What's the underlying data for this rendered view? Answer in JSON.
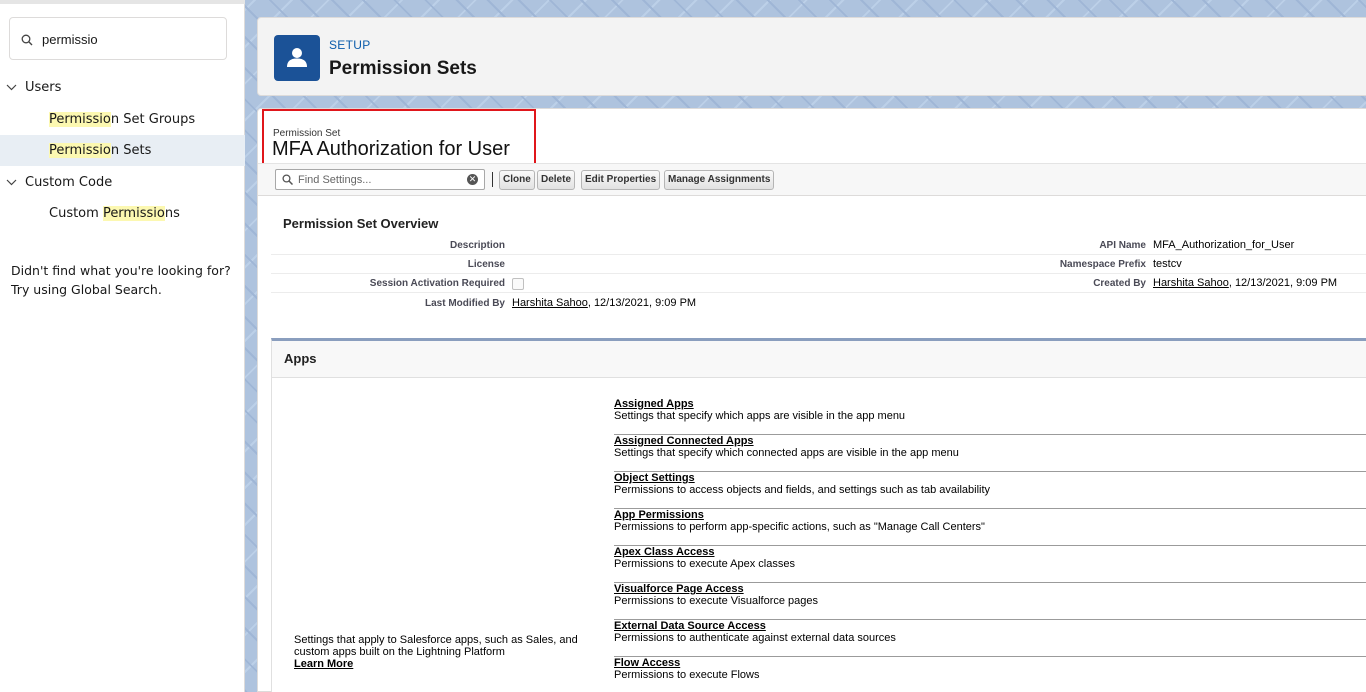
{
  "sidebar": {
    "search_value": "permissio",
    "tree": [
      {
        "label": "Users",
        "children": [
          {
            "match": "Permissio",
            "rest": "n Set Groups"
          },
          {
            "match": "Permissio",
            "rest": "n Sets",
            "selected": true
          }
        ]
      },
      {
        "label": "Custom Code",
        "children": [
          {
            "prefix": "Custom ",
            "match": "Permissio",
            "rest": "ns"
          }
        ]
      }
    ],
    "not_found_line1": "Didn't find what you're looking for?",
    "not_found_line2": "Try using Global Search."
  },
  "header": {
    "setup_link": "SETUP",
    "title": "Permission Sets"
  },
  "permission_set": {
    "type_label": "Permission Set",
    "name": "MFA Authorization for User"
  },
  "toolbar": {
    "find_placeholder": "Find Settings...",
    "clone": "Clone",
    "delete": "Delete",
    "edit_properties": "Edit Properties",
    "manage_assignments": "Manage Assignments"
  },
  "overview": {
    "title": "Permission Set Overview",
    "description_label": "Description",
    "description_value": "",
    "license_label": "License",
    "license_value": "",
    "session_label": "Session Activation Required",
    "last_modified_label": "Last Modified By",
    "last_modified_user": "Harshita Sahoo",
    "last_modified_date": ", 12/13/2021, 9:09 PM",
    "api_name_label": "API Name",
    "api_name_value": "MFA_Authorization_for_User",
    "namespace_label": "Namespace Prefix",
    "namespace_value": "testcv",
    "created_by_label": "Created By",
    "created_by_user": "Harshita Sahoo",
    "created_by_date": ", 12/13/2021, 9:09 PM"
  },
  "apps": {
    "title": "Apps",
    "description_line1": "Settings that apply to Salesforce apps, such as Sales, and",
    "description_line2": "custom apps built on the Lightning Platform",
    "learn_more": "Learn More",
    "items": [
      {
        "link": "Assigned Apps",
        "desc": "Settings that specify which apps are visible in the app menu"
      },
      {
        "link": "Assigned Connected Apps",
        "desc": "Settings that specify which connected apps are visible in the app menu"
      },
      {
        "link": "Object Settings",
        "desc": "Permissions to access objects and fields, and settings such as tab availability"
      },
      {
        "link": "App Permissions",
        "desc": "Permissions to perform app-specific actions, such as \"Manage Call Centers\""
      },
      {
        "link": "Apex Class Access",
        "desc": "Permissions to execute Apex classes"
      },
      {
        "link": "Visualforce Page Access",
        "desc": "Permissions to execute Visualforce pages"
      },
      {
        "link": "External Data Source Access",
        "desc": "Permissions to authenticate against external data sources"
      },
      {
        "link": "Flow Access",
        "desc": "Permissions to execute Flows"
      }
    ]
  },
  "colors": {
    "brand_blue": "#0b5cab",
    "icon_bg": "#1b5297",
    "highlight": "#fcf8b1",
    "selected_row": "#e8eef4",
    "callout_red": "#e0161b"
  },
  "icons": [
    "search-icon",
    "chevron-down-icon",
    "user-icon",
    "clear-icon"
  ]
}
